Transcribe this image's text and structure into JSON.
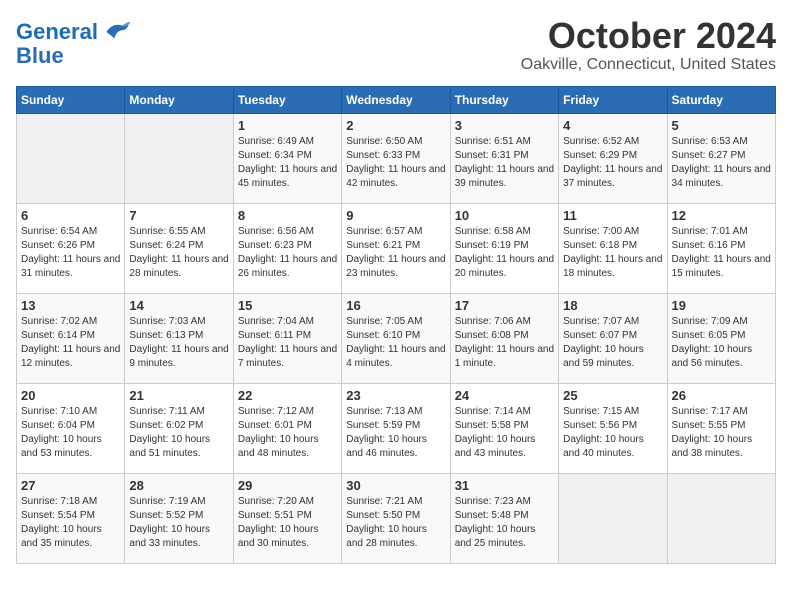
{
  "header": {
    "logo_line1": "General",
    "logo_line2": "Blue",
    "month": "October 2024",
    "location": "Oakville, Connecticut, United States"
  },
  "weekdays": [
    "Sunday",
    "Monday",
    "Tuesday",
    "Wednesday",
    "Thursday",
    "Friday",
    "Saturday"
  ],
  "weeks": [
    [
      null,
      null,
      {
        "day": 1,
        "sunrise": "6:49 AM",
        "sunset": "6:34 PM",
        "daylight": "11 hours and 45 minutes."
      },
      {
        "day": 2,
        "sunrise": "6:50 AM",
        "sunset": "6:33 PM",
        "daylight": "11 hours and 42 minutes."
      },
      {
        "day": 3,
        "sunrise": "6:51 AM",
        "sunset": "6:31 PM",
        "daylight": "11 hours and 39 minutes."
      },
      {
        "day": 4,
        "sunrise": "6:52 AM",
        "sunset": "6:29 PM",
        "daylight": "11 hours and 37 minutes."
      },
      {
        "day": 5,
        "sunrise": "6:53 AM",
        "sunset": "6:27 PM",
        "daylight": "11 hours and 34 minutes."
      }
    ],
    [
      {
        "day": 6,
        "sunrise": "6:54 AM",
        "sunset": "6:26 PM",
        "daylight": "11 hours and 31 minutes."
      },
      {
        "day": 7,
        "sunrise": "6:55 AM",
        "sunset": "6:24 PM",
        "daylight": "11 hours and 28 minutes."
      },
      {
        "day": 8,
        "sunrise": "6:56 AM",
        "sunset": "6:23 PM",
        "daylight": "11 hours and 26 minutes."
      },
      {
        "day": 9,
        "sunrise": "6:57 AM",
        "sunset": "6:21 PM",
        "daylight": "11 hours and 23 minutes."
      },
      {
        "day": 10,
        "sunrise": "6:58 AM",
        "sunset": "6:19 PM",
        "daylight": "11 hours and 20 minutes."
      },
      {
        "day": 11,
        "sunrise": "7:00 AM",
        "sunset": "6:18 PM",
        "daylight": "11 hours and 18 minutes."
      },
      {
        "day": 12,
        "sunrise": "7:01 AM",
        "sunset": "6:16 PM",
        "daylight": "11 hours and 15 minutes."
      }
    ],
    [
      {
        "day": 13,
        "sunrise": "7:02 AM",
        "sunset": "6:14 PM",
        "daylight": "11 hours and 12 minutes."
      },
      {
        "day": 14,
        "sunrise": "7:03 AM",
        "sunset": "6:13 PM",
        "daylight": "11 hours and 9 minutes."
      },
      {
        "day": 15,
        "sunrise": "7:04 AM",
        "sunset": "6:11 PM",
        "daylight": "11 hours and 7 minutes."
      },
      {
        "day": 16,
        "sunrise": "7:05 AM",
        "sunset": "6:10 PM",
        "daylight": "11 hours and 4 minutes."
      },
      {
        "day": 17,
        "sunrise": "7:06 AM",
        "sunset": "6:08 PM",
        "daylight": "11 hours and 1 minute."
      },
      {
        "day": 18,
        "sunrise": "7:07 AM",
        "sunset": "6:07 PM",
        "daylight": "10 hours and 59 minutes."
      },
      {
        "day": 19,
        "sunrise": "7:09 AM",
        "sunset": "6:05 PM",
        "daylight": "10 hours and 56 minutes."
      }
    ],
    [
      {
        "day": 20,
        "sunrise": "7:10 AM",
        "sunset": "6:04 PM",
        "daylight": "10 hours and 53 minutes."
      },
      {
        "day": 21,
        "sunrise": "7:11 AM",
        "sunset": "6:02 PM",
        "daylight": "10 hours and 51 minutes."
      },
      {
        "day": 22,
        "sunrise": "7:12 AM",
        "sunset": "6:01 PM",
        "daylight": "10 hours and 48 minutes."
      },
      {
        "day": 23,
        "sunrise": "7:13 AM",
        "sunset": "5:59 PM",
        "daylight": "10 hours and 46 minutes."
      },
      {
        "day": 24,
        "sunrise": "7:14 AM",
        "sunset": "5:58 PM",
        "daylight": "10 hours and 43 minutes."
      },
      {
        "day": 25,
        "sunrise": "7:15 AM",
        "sunset": "5:56 PM",
        "daylight": "10 hours and 40 minutes."
      },
      {
        "day": 26,
        "sunrise": "7:17 AM",
        "sunset": "5:55 PM",
        "daylight": "10 hours and 38 minutes."
      }
    ],
    [
      {
        "day": 27,
        "sunrise": "7:18 AM",
        "sunset": "5:54 PM",
        "daylight": "10 hours and 35 minutes."
      },
      {
        "day": 28,
        "sunrise": "7:19 AM",
        "sunset": "5:52 PM",
        "daylight": "10 hours and 33 minutes."
      },
      {
        "day": 29,
        "sunrise": "7:20 AM",
        "sunset": "5:51 PM",
        "daylight": "10 hours and 30 minutes."
      },
      {
        "day": 30,
        "sunrise": "7:21 AM",
        "sunset": "5:50 PM",
        "daylight": "10 hours and 28 minutes."
      },
      {
        "day": 31,
        "sunrise": "7:23 AM",
        "sunset": "5:48 PM",
        "daylight": "10 hours and 25 minutes."
      },
      null,
      null
    ]
  ]
}
